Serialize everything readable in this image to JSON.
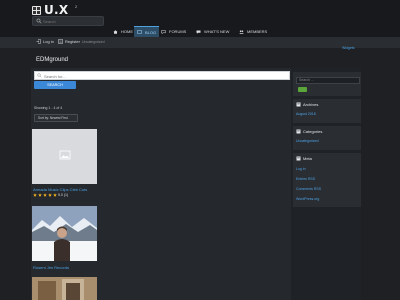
{
  "site": {
    "logo_text": "U.X",
    "logo_sup": "2",
    "search_placeholder": "Search"
  },
  "nav": [
    {
      "label": "HOME"
    },
    {
      "label": "BLOG"
    },
    {
      "label": "FORUMS"
    },
    {
      "label": "WHAT'S NEW"
    },
    {
      "label": "MEMBERS"
    }
  ],
  "subbar": {
    "login": "Log in",
    "register": "Register",
    "crumb": "Uncategorized",
    "right_link": "Widgets"
  },
  "page_title": "EDMground",
  "main": {
    "search_placeholder": "Search for...",
    "search_button": "SEARCH",
    "showing": "Showing 1 - 4 of 4",
    "sort_label": "Sort by: Newest First",
    "items": [
      {
        "title": "Armada Music Clips Cleb Cuts",
        "rating_text": "5.0 (1)",
        "stars": 5
      },
      {
        "title": "Rosent Jim Records"
      }
    ]
  },
  "sidebar": {
    "search_placeholder": "Search ...",
    "archives": {
      "title": "Archives",
      "links": [
        "August 2018"
      ]
    },
    "categories": {
      "title": "Categories",
      "links": [
        "Uncategorized"
      ]
    },
    "meta": {
      "title": "Meta",
      "links": [
        "Log in",
        "Entries RSS",
        "Comments RSS",
        "WordPress.org"
      ]
    }
  }
}
